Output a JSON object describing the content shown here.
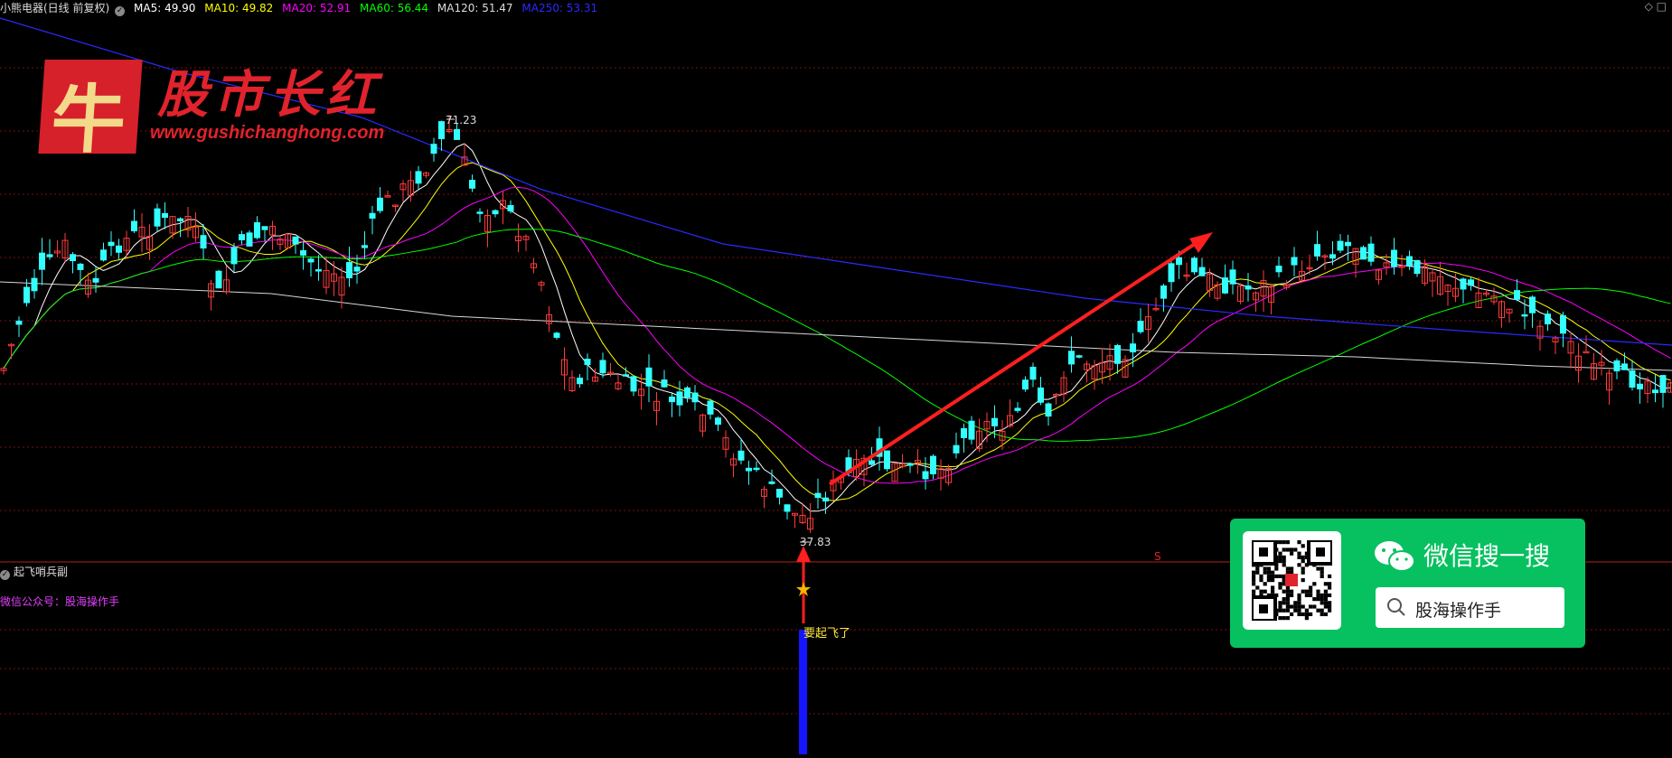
{
  "header": {
    "stock": "小熊电器(日线 前复权)",
    "ma5": "MA5: 49.90",
    "ma10": "MA10: 49.82",
    "ma20": "MA20: 52.91",
    "ma60": "MA60: 56.44",
    "ma120": "MA120: 51.47",
    "ma250": "MA250: 53.31",
    "corner": "◇ □",
    "colors": {
      "ma5": "#ffffff",
      "ma10": "#ffff00",
      "ma20": "#ff00ff",
      "ma60": "#00ff00",
      "ma120": "#ffffff",
      "ma250": "#2a2aff"
    }
  },
  "logo": {
    "mark": "牛",
    "title": "股市长红",
    "url": "www.gushichanghong.com"
  },
  "annotations": {
    "high": "71.23",
    "low": "37.83",
    "signal": "要起飞了",
    "mark_s": "S"
  },
  "subchart": {
    "title": "起飞哨兵副",
    "note": "微信公众号：股海操作手",
    "signal_icon": "star-icon"
  },
  "wechat": {
    "title": "微信搜一搜",
    "search_text": "股海操作手",
    "icon": "wechat-icon",
    "search_icon": "search-icon"
  },
  "colors": {
    "up": "#ff3b3b",
    "down": "#33ffff",
    "grid": "#7a1010",
    "arrow": "#ff1f1f",
    "signal_bar": "#1515ff"
  }
}
